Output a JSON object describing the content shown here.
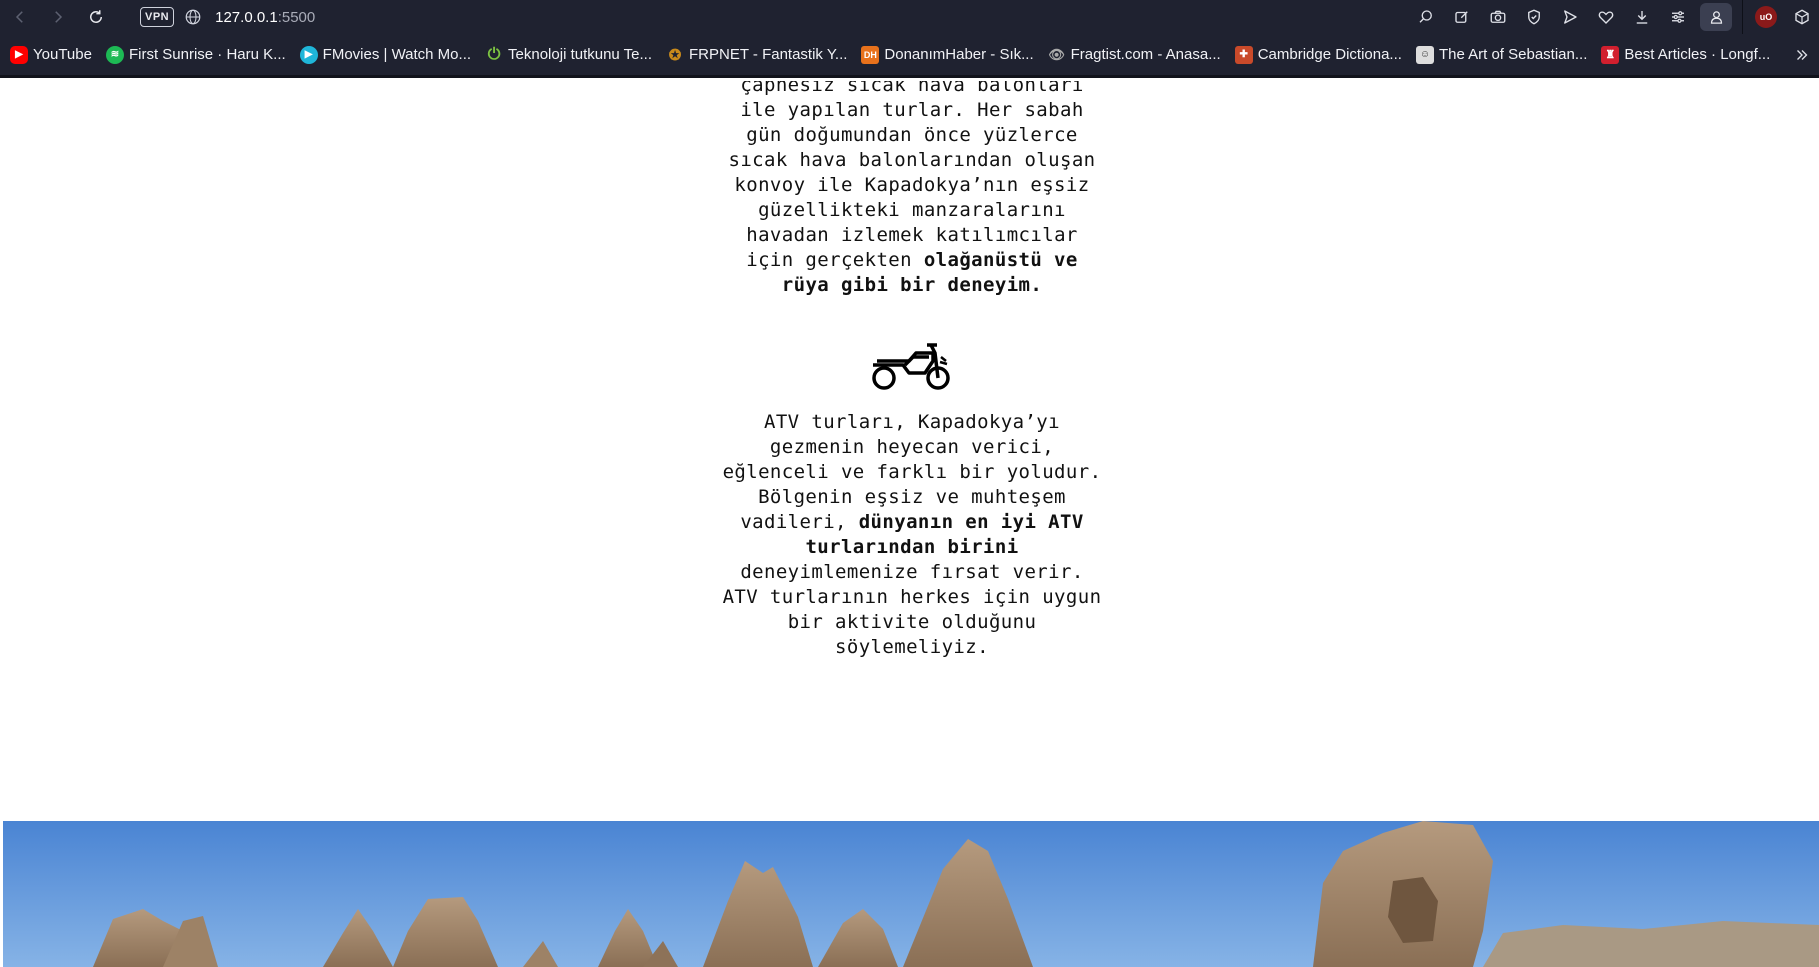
{
  "browser": {
    "url_host": "127.0.0.1",
    "url_port": ":5500",
    "vpn_label": "VPN",
    "colors": {
      "toolbar_bg": "#1f2230",
      "text": "#f1f2f6"
    },
    "toolbar_icons": [
      "search-in-page-icon",
      "edit-icon",
      "camera-icon",
      "shield-check-icon",
      "send-icon",
      "heart-icon",
      "download-icon",
      "easy-setup-icon",
      "profile-icon",
      "ublock-icon",
      "extensions-cube-icon"
    ],
    "ublock_label": "uO"
  },
  "bookmarks": [
    {
      "label": "YouTube",
      "icon": "youtube-icon",
      "color": "#ff0000"
    },
    {
      "label": "First Sunrise · Haru K...",
      "icon": "spotify-icon",
      "color": "#1db954"
    },
    {
      "label": "FMovies | Watch Mo...",
      "icon": "fmovies-icon",
      "color": "#1fb6d9"
    },
    {
      "label": "Teknoloji tutkunu Te...",
      "icon": "power-icon",
      "color": "#7cc242"
    },
    {
      "label": "FRPNET - Fantastik Y...",
      "icon": "frpnet-icon",
      "color": "#c98a1b"
    },
    {
      "label": "DonanımHaber - Sık...",
      "icon": "dh-icon",
      "color": "#e8721c"
    },
    {
      "label": "Fragtist.com - Anasa...",
      "icon": "fragtist-icon",
      "color": "#888888"
    },
    {
      "label": "Cambridge Dictiona...",
      "icon": "cambridge-icon",
      "color": "#c94a2a"
    },
    {
      "label": "The Art of Sebastian...",
      "icon": "sebastian-icon",
      "color": "#dddddd"
    },
    {
      "label": "Best Articles · Longf...",
      "icon": "longform-icon",
      "color": "#d11f2e"
    }
  ],
  "page": {
    "block1": {
      "lines": [
        "çapnesız sıcak hava balonları",
        "ile yapılan turlar. Her sabah",
        "gün doğumundan önce yüzlerce",
        "sıcak hava balonlarından oluşan",
        "konvoy ile Kapadokya’nın eşsiz",
        "güzellikteki manzaralarını",
        "havadan izlemek katılımcılar",
        "için gerçekten "
      ],
      "bold_1": "olağanüstü ve",
      "bold_2": "rüya gibi bir deneyim."
    },
    "atv_icon": "motorcycle-icon",
    "block2": {
      "lines_a": [
        "ATV turları, Kapadokya’yı",
        "gezmenin heyecan verici,",
        "eğlenceli ve farklı bir yoludur.",
        "Bölgenin eşsiz ve muhteşem",
        "vadileri, "
      ],
      "bold_1": "dünyanın en iyi ATV",
      "bold_2": "turlarından birini",
      "lines_b": [
        "deneyimlemenize fırsat verir.",
        "ATV turlarının herkes için uygun",
        "bir aktivite olduğunu",
        "söylemeliyiz."
      ]
    },
    "photo": {
      "subject": "fairy-chimneys-image",
      "sky_color": "#5b8fd6"
    }
  }
}
